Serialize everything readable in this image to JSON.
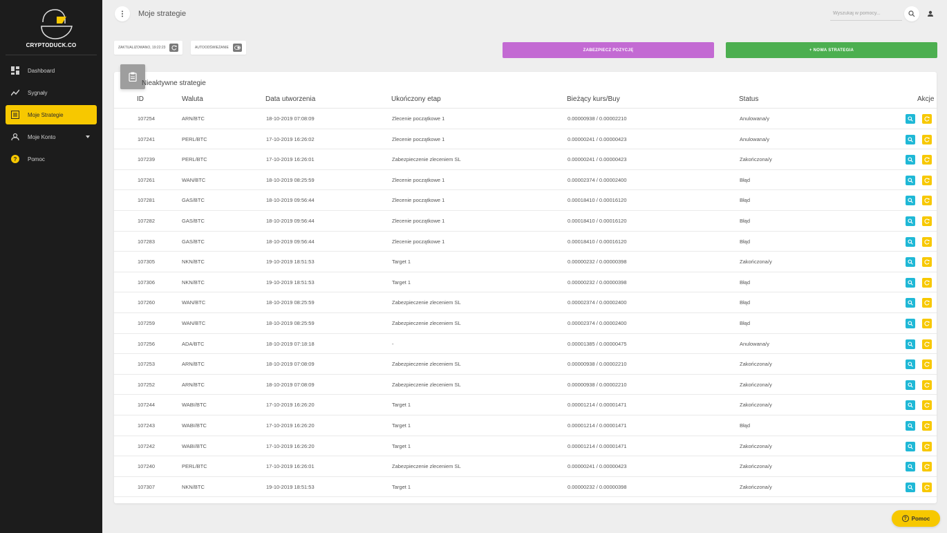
{
  "app": {
    "brand": "CRYPTODUCK.CO"
  },
  "sidebar": {
    "items": [
      {
        "label": "Dashboard",
        "icon": "dashboard-icon"
      },
      {
        "label": "Sygnały",
        "icon": "trend-icon"
      },
      {
        "label": "Moje Strategie",
        "icon": "list-icon",
        "active": true
      },
      {
        "label": "Moje Konto",
        "icon": "user-icon"
      },
      {
        "label": "Pomoc",
        "icon": "help-icon"
      }
    ]
  },
  "header": {
    "title": "Moje strategie",
    "search_placeholder": "Wyszukaj w pomocy..."
  },
  "toolbar": {
    "updated_label": "ZAKTUALIZOWANO, 19:22:23",
    "autorefresh_label": "AUTOODŚWIEŻANIE",
    "secure_label": "ZABEZPIECZ POZYCJĘ",
    "new_label": "+ NOWA STRATEGIA"
  },
  "card": {
    "title": "Nieaktywne strategie",
    "columns": [
      "ID",
      "Waluta",
      "Data utworzenia",
      "Ukończony etap",
      "Bieżący kurs/Buy",
      "Status",
      "Akcje"
    ]
  },
  "rows": [
    [
      "107254",
      "ARN/BTC",
      "18-10-2019 07:08:09",
      "Zlecenie początkowe 1",
      "0.00000938 / 0.00002210",
      "Anulowana/y"
    ],
    [
      "107241",
      "PERL/BTC",
      "17-10-2019 16:26:02",
      "Zlecenie początkowe 1",
      "0.00000241 / 0.00000423",
      "Anulowana/y"
    ],
    [
      "107239",
      "PERL/BTC",
      "17-10-2019 16:26:01",
      "Zabezpieczenie zleceniem SL",
      "0.00000241 / 0.00000423",
      "Zakończona/y"
    ],
    [
      "107261",
      "WAN/BTC",
      "18-10-2019 08:25:59",
      "Zlecenie początkowe 1",
      "0.00002374 / 0.00002400",
      "Błąd"
    ],
    [
      "107281",
      "GAS/BTC",
      "18-10-2019 09:56:44",
      "Zlecenie początkowe 1",
      "0.00018410 / 0.00016120",
      "Błąd"
    ],
    [
      "107282",
      "GAS/BTC",
      "18-10-2019 09:56:44",
      "Zlecenie początkowe 1",
      "0.00018410 / 0.00016120",
      "Błąd"
    ],
    [
      "107283",
      "GAS/BTC",
      "18-10-2019 09:56:44",
      "Zlecenie początkowe 1",
      "0.00018410 / 0.00016120",
      "Błąd"
    ],
    [
      "107305",
      "NKN/BTC",
      "19-10-2019 18:51:53",
      "Target 1",
      "0.00000232 / 0.00000398",
      "Zakończona/y"
    ],
    [
      "107306",
      "NKN/BTC",
      "19-10-2019 18:51:53",
      "Target 1",
      "0.00000232 / 0.00000398",
      "Błąd"
    ],
    [
      "107260",
      "WAN/BTC",
      "18-10-2019 08:25:59",
      "Zabezpieczenie zleceniem SL",
      "0.00002374 / 0.00002400",
      "Błąd"
    ],
    [
      "107259",
      "WAN/BTC",
      "18-10-2019 08:25:59",
      "Zabezpieczenie zleceniem SL",
      "0.00002374 / 0.00002400",
      "Błąd"
    ],
    [
      "107256",
      "ADA/BTC",
      "18-10-2019 07:18:18",
      "-",
      "0.00001385 / 0.00000475",
      "Anulowana/y"
    ],
    [
      "107253",
      "ARN/BTC",
      "18-10-2019 07:08:09",
      "Zabezpieczenie zleceniem SL",
      "0.00000938 / 0.00002210",
      "Zakończona/y"
    ],
    [
      "107252",
      "ARN/BTC",
      "18-10-2019 07:08:09",
      "Zabezpieczenie zleceniem SL",
      "0.00000938 / 0.00002210",
      "Zakończona/y"
    ],
    [
      "107244",
      "WABI/BTC",
      "17-10-2019 16:26:20",
      "Target 1",
      "0.00001214 / 0.00001471",
      "Zakończona/y"
    ],
    [
      "107243",
      "WABI/BTC",
      "17-10-2019 16:26:20",
      "Target 1",
      "0.00001214 / 0.00001471",
      "Błąd"
    ],
    [
      "107242",
      "WABI/BTC",
      "17-10-2019 16:26:20",
      "Target 1",
      "0.00001214 / 0.00001471",
      "Zakończona/y"
    ],
    [
      "107240",
      "PERL/BTC",
      "17-10-2019 16:26:01",
      "Zabezpieczenie zleceniem SL",
      "0.00000241 / 0.00000423",
      "Zakończona/y"
    ],
    [
      "107307",
      "NKN/BTC",
      "19-10-2019 18:51:53",
      "Target 1",
      "0.00000232 / 0.00000398",
      "Zakończona/y"
    ]
  ],
  "help_button": {
    "label": "Pomoc"
  },
  "colors": {
    "sidebar_bg": "#1c1c1c",
    "accent_yellow": "#f7c800",
    "purple": "#c36ad3",
    "green": "#4caf50",
    "cyan": "#1fb8d6"
  }
}
